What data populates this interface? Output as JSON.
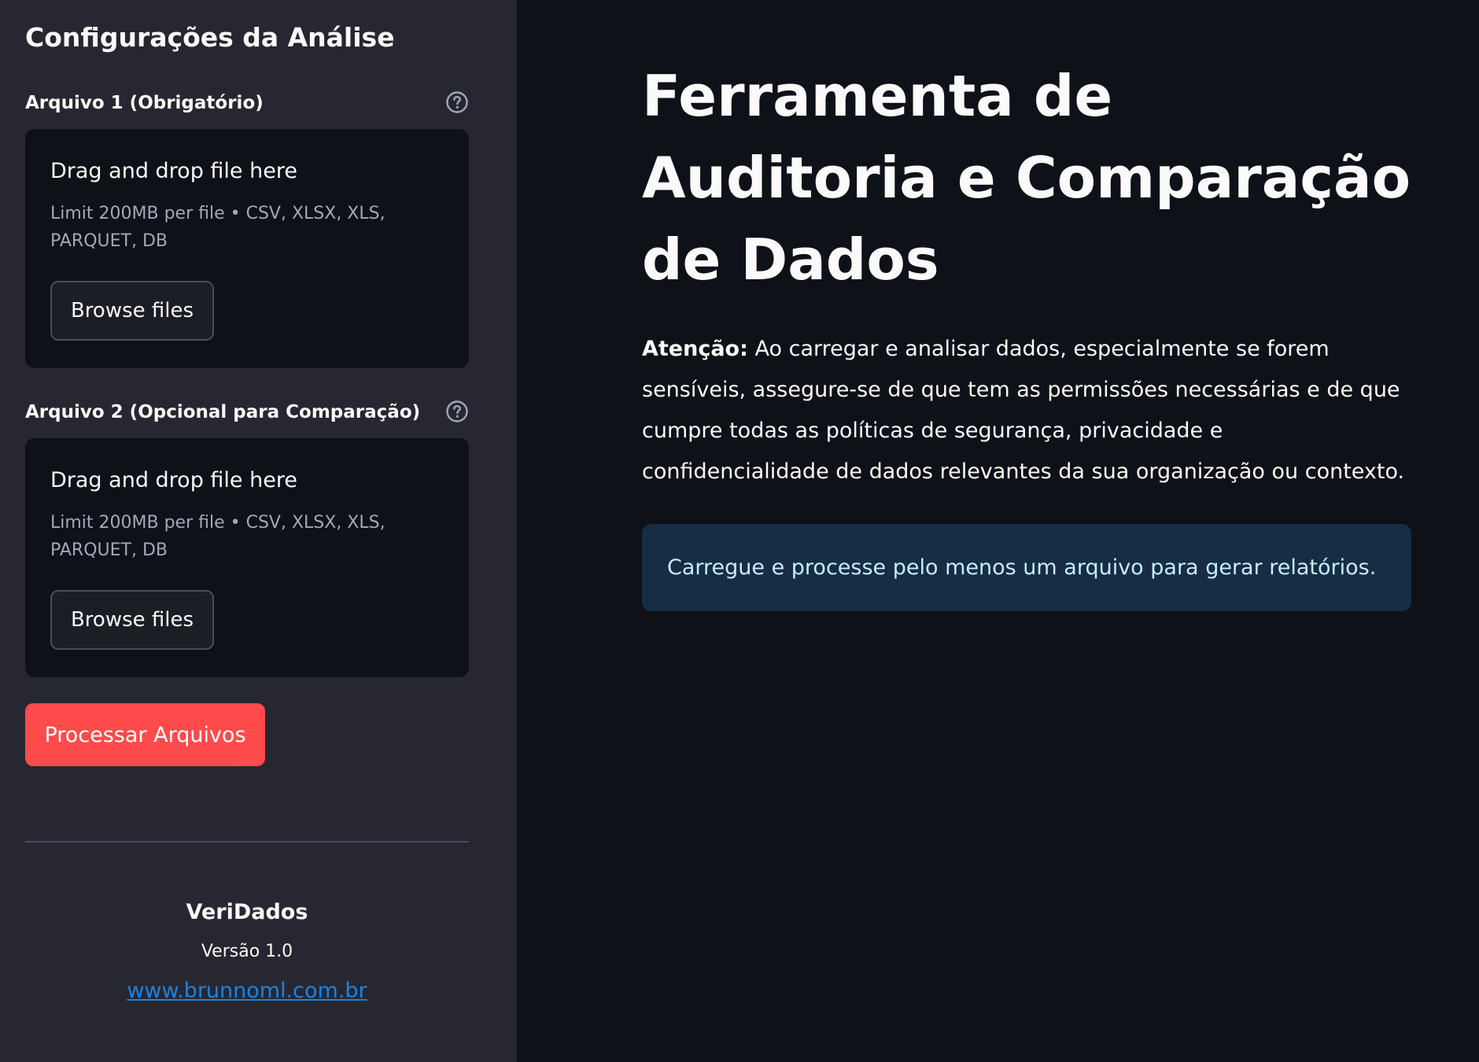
{
  "sidebar": {
    "title": "Configurações da Análise",
    "uploaders": [
      {
        "label": "Arquivo 1 (Obrigatório)",
        "dropzone_title": "Drag and drop file here",
        "limit_text": "Limit 200MB per file • CSV, XLSX, XLS, PARQUET, DB",
        "browse_label": "Browse files"
      },
      {
        "label": "Arquivo 2 (Opcional para Comparação)",
        "dropzone_title": "Drag and drop file here",
        "limit_text": "Limit 200MB per file • CSV, XLSX, XLS, PARQUET, DB",
        "browse_label": "Browse files"
      }
    ],
    "process_button": "Processar Arquivos",
    "footer": {
      "app_name": "VeriDados",
      "version": "Versão 1.0",
      "link": "www.brunnoml.com.br"
    }
  },
  "main": {
    "title": "Ferramenta de Auditoria e Comparação de Dados",
    "warning": {
      "label": "Atenção:",
      "text": " Ao carregar e analisar dados, especialmente se forem sensíveis, assegure-se de que tem as permissões necessárias e de que cumpre todas as políticas de segurança, privacidade e confidencialidade de dados relevantes da sua organização ou contexto."
    },
    "info": "Carregue e processe pelo menos um arquivo para gerar relatórios."
  },
  "icons": {
    "help": "help-circle-icon"
  },
  "colors": {
    "primary": "#ff4b4b",
    "sidebar_bg": "#262730",
    "main_bg": "#0e1117",
    "info_bg": "#172d43",
    "info_text": "#c7ebff",
    "link": "#1c83e1"
  }
}
